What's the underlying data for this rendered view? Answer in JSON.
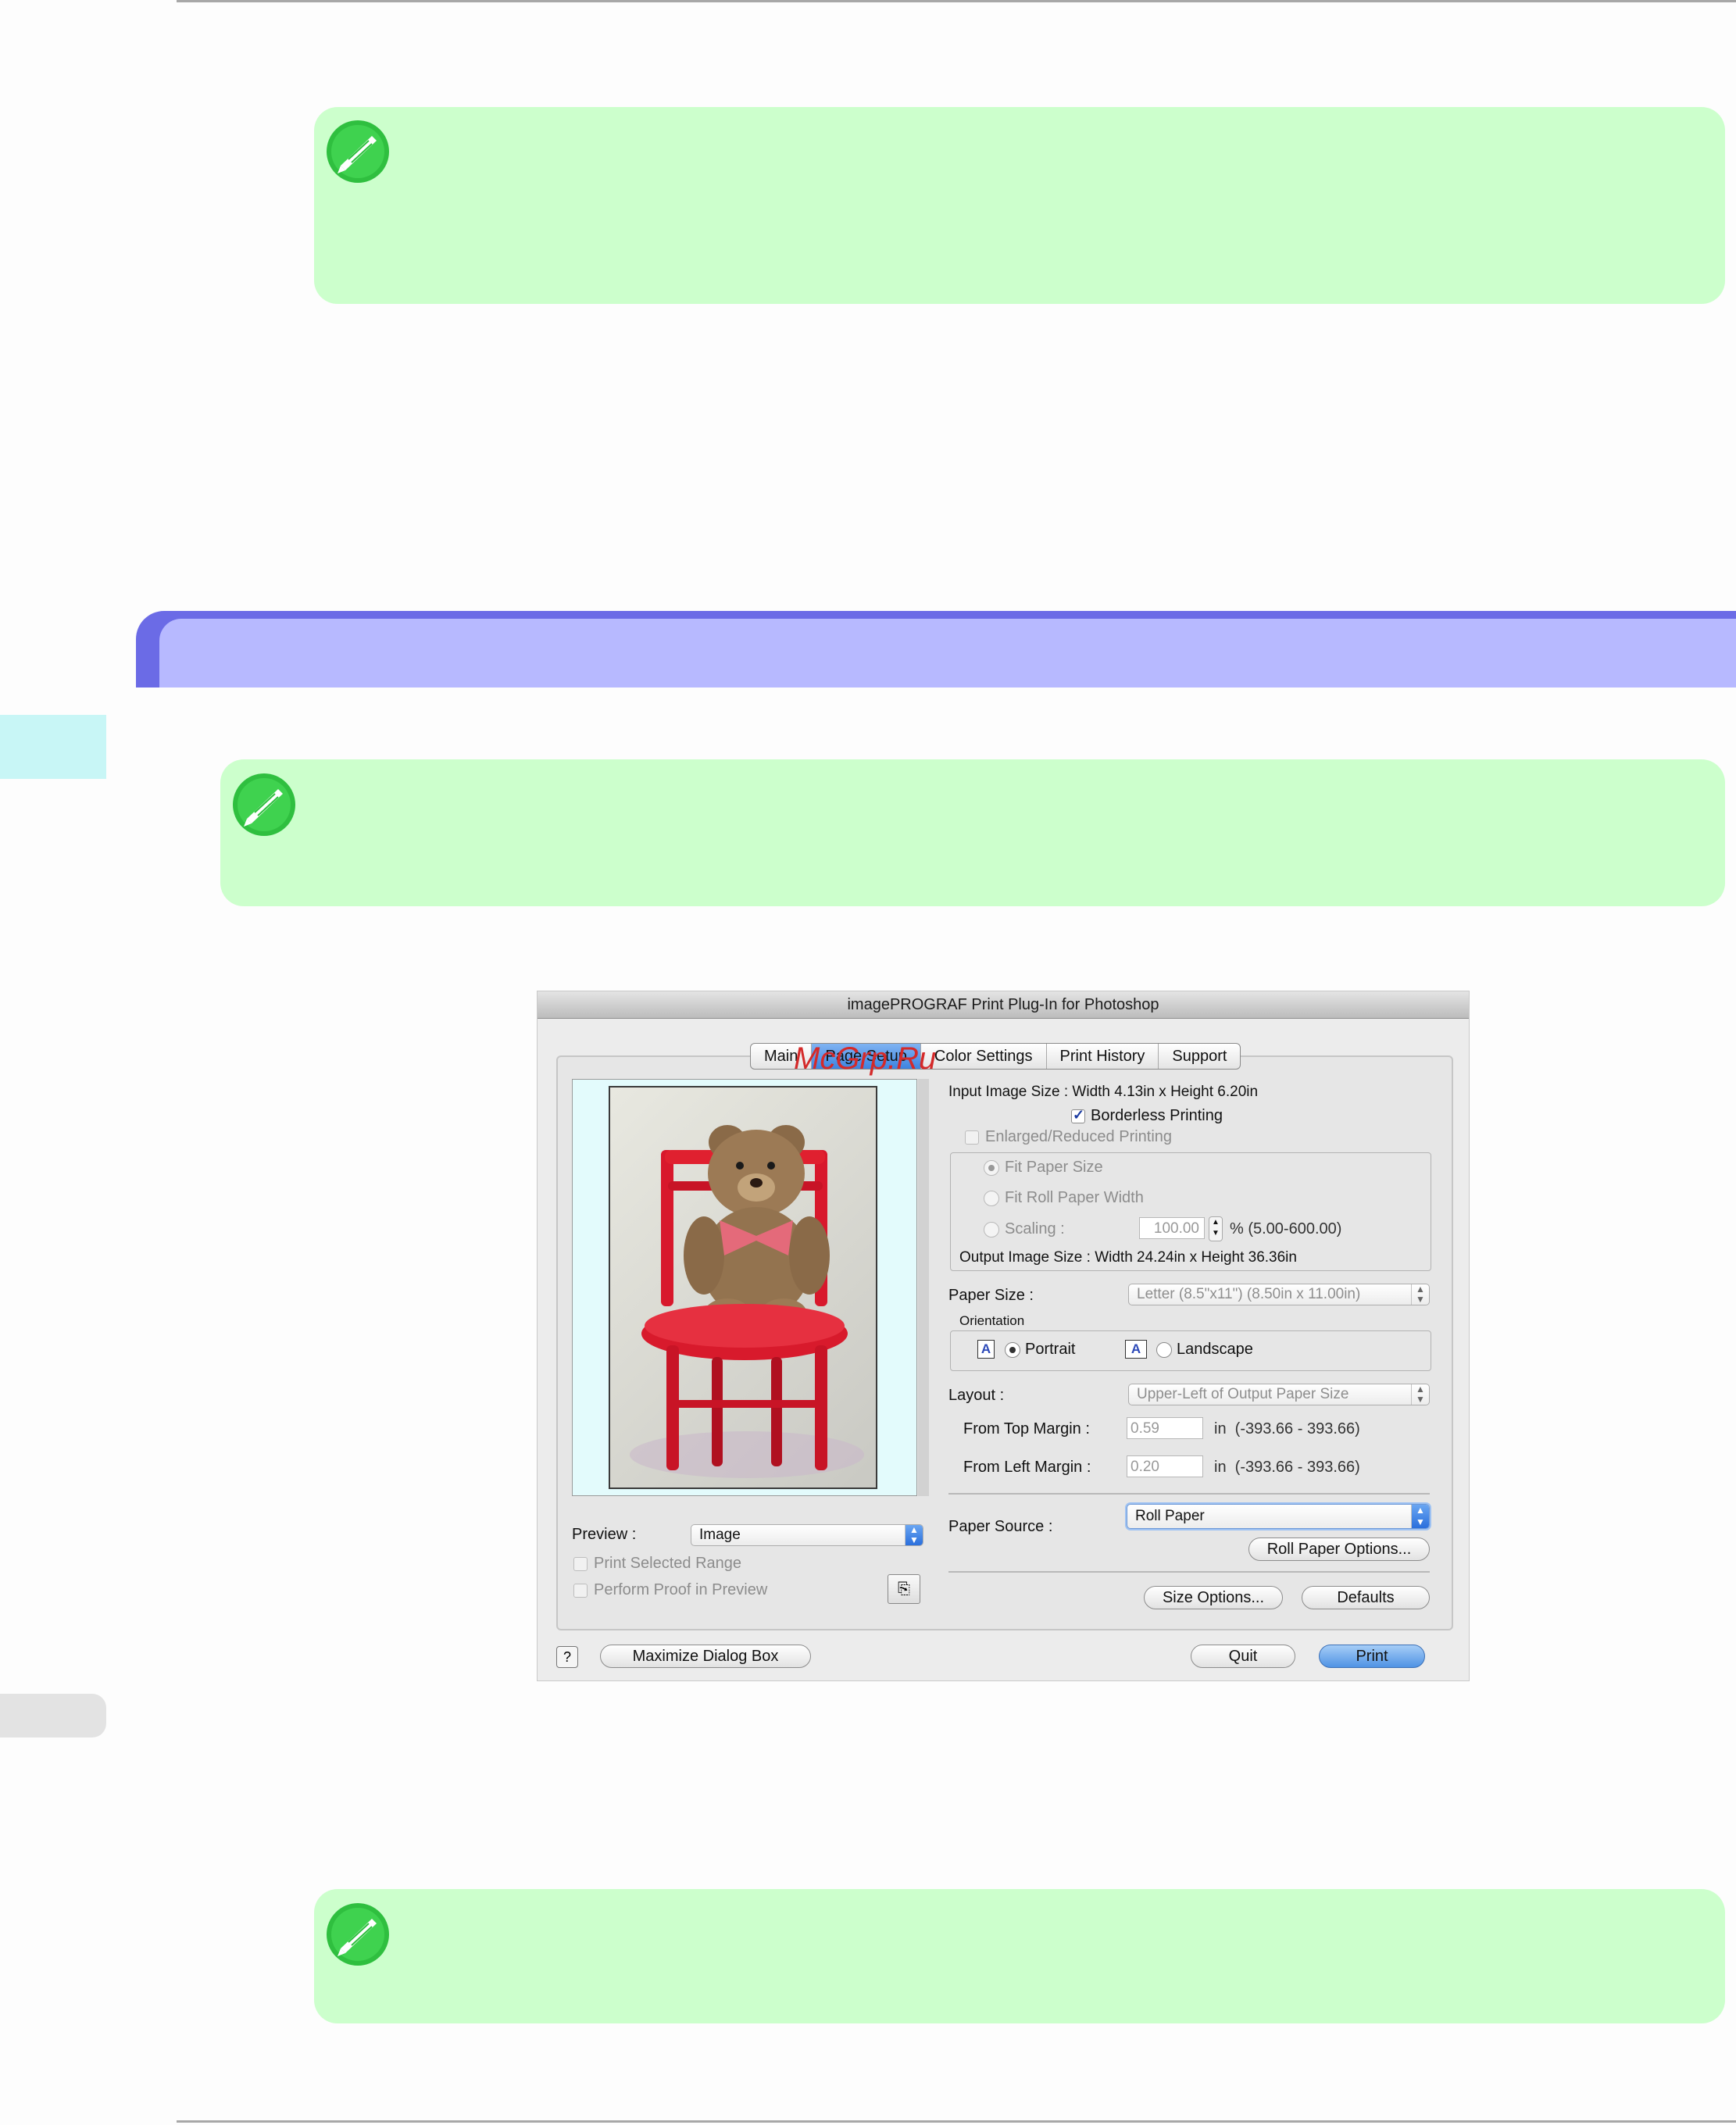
{
  "dialog": {
    "title": "imagePROGRAF Print Plug-In for Photoshop",
    "tabs": [
      "Main",
      "Page Setup",
      "Color Settings",
      "Print History",
      "Support"
    ],
    "watermark": "McGrp.Ru",
    "input_image_size": "Input Image Size : Width 4.13in x Height 6.20in",
    "borderless_printing": "Borderless Printing",
    "enlarged_reduced_printing": "Enlarged/Reduced Printing",
    "fit_paper_size": "Fit Paper Size",
    "fit_roll_paper_width": "Fit Roll Paper Width",
    "scaling_label": "Scaling :",
    "scaling_value": "100.00",
    "scaling_range": "% (5.00-600.00)",
    "output_image_size": "Output Image Size : Width 24.24in x Height 36.36in",
    "paper_size_label": "Paper Size :",
    "paper_size_value": "Letter (8.5\"x11\") (8.50in x 11.00in)",
    "orientation_label": "Orientation",
    "portrait": "Portrait",
    "landscape": "Landscape",
    "orientation_icon_glyph": "A",
    "layout_label": "Layout :",
    "layout_value": "Upper-Left of Output Paper Size",
    "from_top_margin_label": "From Top Margin :",
    "from_top_margin_value": "0.59",
    "from_top_margin_unit": "in  (-393.66 - 393.66)",
    "from_left_margin_label": "From Left Margin :",
    "from_left_margin_value": "0.20",
    "from_left_margin_unit": "in  (-393.66 - 393.66)",
    "paper_source_label": "Paper Source :",
    "paper_source_value": "Roll Paper",
    "roll_paper_options": "Roll Paper Options...",
    "size_options": "Size Options...",
    "defaults": "Defaults",
    "preview_label": "Preview :",
    "preview_value": "Image",
    "print_selected_range": "Print Selected Range",
    "perform_proof_in_preview": "Perform Proof in Preview",
    "help_glyph": "?",
    "maximize_dialog_box": "Maximize Dialog Box",
    "quit": "Quit",
    "print": "Print"
  },
  "colors": {
    "note_background": "#ccffcc",
    "section_bar": "#6b6be6",
    "section_bar_inner": "#b7b9ff",
    "side_tab": "#c8f6f6"
  },
  "icons": {
    "note": "pencil-note-icon",
    "help": "help-icon",
    "proof": "proof-preview-icon"
  }
}
